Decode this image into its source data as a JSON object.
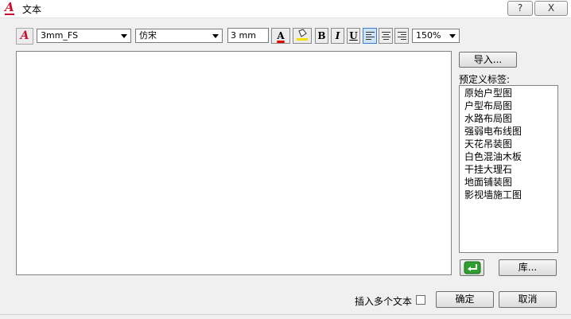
{
  "window": {
    "title": "文本",
    "help_label": "?",
    "close_label": "X"
  },
  "toolbar": {
    "style_icon": "A",
    "font_style": "3mm_FS",
    "font_family": "仿宋",
    "text_height": "3 mm",
    "color_label": "A",
    "bold_label": "B",
    "italic_label": "I",
    "underline_label": "U",
    "zoom": "150%",
    "colors": {
      "text_color": "#e00000",
      "highlight": "#f5e000",
      "active_align": "#3a7bd5"
    }
  },
  "side": {
    "import_label": "导入...",
    "preset_label": "预定义标签:",
    "presets": [
      "原始户型图",
      "户型布局图",
      "水路布局图",
      "强弱电布线图",
      "天花吊装图",
      "白色混油木板",
      "干挂大理石",
      "地面铺装图",
      "影视墙施工图"
    ],
    "library_label": "库..."
  },
  "footer": {
    "multi_text_label": "插入多个文本",
    "ok_label": "确定",
    "cancel_label": "取消"
  }
}
